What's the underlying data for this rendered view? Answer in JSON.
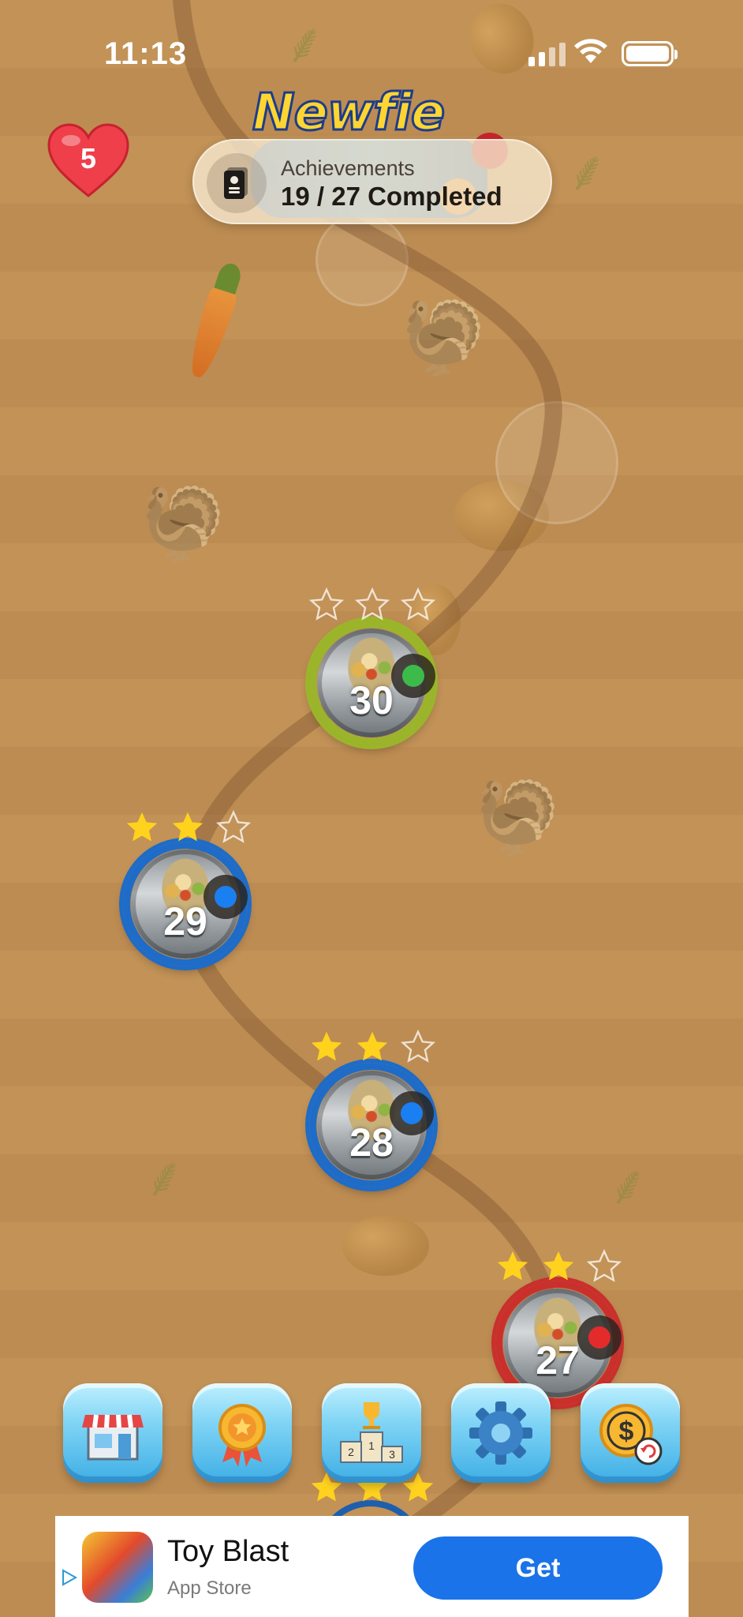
{
  "status_bar": {
    "time": "11:13"
  },
  "lives": {
    "count": "5"
  },
  "logo": {
    "text": "Newfie"
  },
  "achievements": {
    "title": "Achievements",
    "progress": "19 / 27 Completed"
  },
  "levels": [
    {
      "number": "30",
      "stars": 0,
      "ring_color": "#9bb52a",
      "badge_color": "#3dbb4a",
      "badge_icon": "leaf-icon"
    },
    {
      "number": "29",
      "stars": 2,
      "ring_color": "#1e6cc8",
      "badge_color": "#1a7ff0",
      "badge_icon": "dot-icon"
    },
    {
      "number": "28",
      "stars": 2,
      "ring_color": "#1e6cc8",
      "badge_color": "#1a7ff0",
      "badge_icon": "dot-icon"
    },
    {
      "number": "27",
      "stars": 2,
      "ring_color": "#c9302c",
      "badge_color": "#e32b2b",
      "badge_icon": "flame-icon"
    }
  ],
  "toolbar": [
    {
      "name": "shop",
      "icon": "shop-icon"
    },
    {
      "name": "badges",
      "icon": "medal-icon"
    },
    {
      "name": "leaderboard",
      "icon": "trophy-podium-icon"
    },
    {
      "name": "settings",
      "icon": "gear-icon"
    },
    {
      "name": "purchases",
      "icon": "coin-restore-icon"
    }
  ],
  "ad": {
    "app_name": "Toy Blast",
    "store": "App Store",
    "cta": "Get"
  },
  "colors": {
    "star_filled": "#ffd21e",
    "background": "#c29257",
    "ad_button": "#1a73e8"
  }
}
